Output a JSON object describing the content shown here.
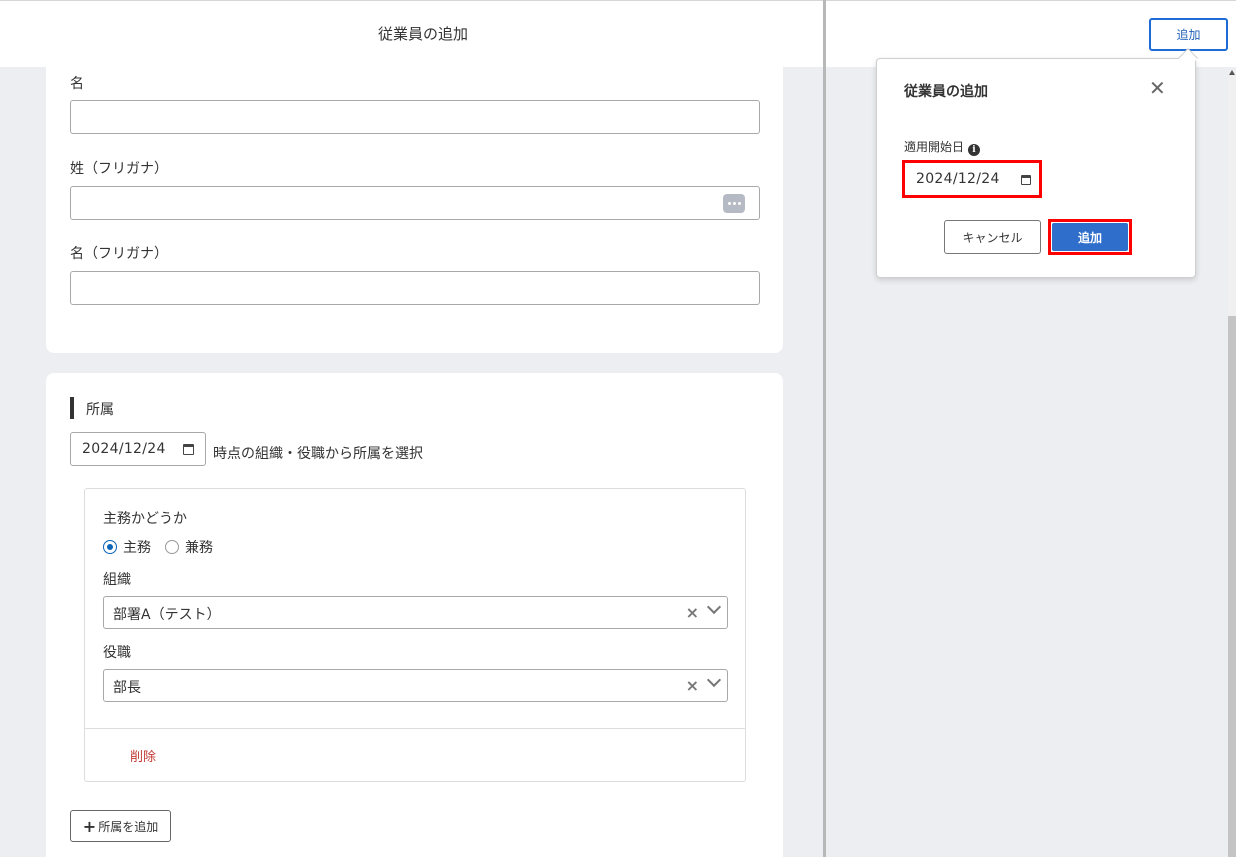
{
  "left": {
    "title": "従業員の追加",
    "fields": {
      "first_name": {
        "label": "名",
        "value": ""
      },
      "last_name_kana": {
        "label": "姓（フリガナ）",
        "value": ""
      },
      "first_name_kana": {
        "label": "名（フリガナ）",
        "value": ""
      }
    },
    "affiliation": {
      "section_title": "所属",
      "date_value": "2024/12/24",
      "date_suffix": "時点の組織・役職から所属を選択",
      "primary_label": "主務かどうか",
      "radio_primary": "主務",
      "radio_secondary": "兼務",
      "primary_selected": "主務",
      "org_label": "組織",
      "org_value": "部署A（テスト）",
      "position_label": "役職",
      "position_value": "部長",
      "delete_label": "削除",
      "add_button_label": "所属を追加"
    }
  },
  "right": {
    "top_add_label": "追加",
    "popover": {
      "title": "従業員の追加",
      "start_date_label": "適用開始日",
      "start_date_value": "2024/12/24",
      "cancel_label": "キャンセル",
      "add_label": "追加"
    }
  },
  "colors": {
    "primary": "#2f6fcb",
    "highlight": "#ff0000",
    "danger": "#c23934",
    "background": "#eceef1"
  }
}
